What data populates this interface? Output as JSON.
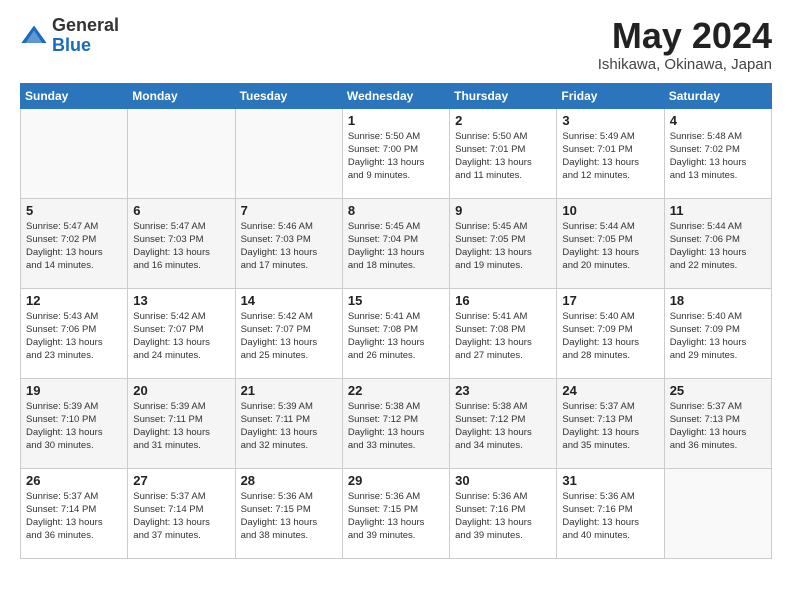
{
  "header": {
    "logo_general": "General",
    "logo_blue": "Blue",
    "title_month": "May 2024",
    "title_location": "Ishikawa, Okinawa, Japan"
  },
  "days_of_week": [
    "Sunday",
    "Monday",
    "Tuesday",
    "Wednesday",
    "Thursday",
    "Friday",
    "Saturday"
  ],
  "weeks": [
    [
      {
        "num": "",
        "info": ""
      },
      {
        "num": "",
        "info": ""
      },
      {
        "num": "",
        "info": ""
      },
      {
        "num": "1",
        "info": "Sunrise: 5:50 AM\nSunset: 7:00 PM\nDaylight: 13 hours\nand 9 minutes."
      },
      {
        "num": "2",
        "info": "Sunrise: 5:50 AM\nSunset: 7:01 PM\nDaylight: 13 hours\nand 11 minutes."
      },
      {
        "num": "3",
        "info": "Sunrise: 5:49 AM\nSunset: 7:01 PM\nDaylight: 13 hours\nand 12 minutes."
      },
      {
        "num": "4",
        "info": "Sunrise: 5:48 AM\nSunset: 7:02 PM\nDaylight: 13 hours\nand 13 minutes."
      }
    ],
    [
      {
        "num": "5",
        "info": "Sunrise: 5:47 AM\nSunset: 7:02 PM\nDaylight: 13 hours\nand 14 minutes."
      },
      {
        "num": "6",
        "info": "Sunrise: 5:47 AM\nSunset: 7:03 PM\nDaylight: 13 hours\nand 16 minutes."
      },
      {
        "num": "7",
        "info": "Sunrise: 5:46 AM\nSunset: 7:03 PM\nDaylight: 13 hours\nand 17 minutes."
      },
      {
        "num": "8",
        "info": "Sunrise: 5:45 AM\nSunset: 7:04 PM\nDaylight: 13 hours\nand 18 minutes."
      },
      {
        "num": "9",
        "info": "Sunrise: 5:45 AM\nSunset: 7:05 PM\nDaylight: 13 hours\nand 19 minutes."
      },
      {
        "num": "10",
        "info": "Sunrise: 5:44 AM\nSunset: 7:05 PM\nDaylight: 13 hours\nand 20 minutes."
      },
      {
        "num": "11",
        "info": "Sunrise: 5:44 AM\nSunset: 7:06 PM\nDaylight: 13 hours\nand 22 minutes."
      }
    ],
    [
      {
        "num": "12",
        "info": "Sunrise: 5:43 AM\nSunset: 7:06 PM\nDaylight: 13 hours\nand 23 minutes."
      },
      {
        "num": "13",
        "info": "Sunrise: 5:42 AM\nSunset: 7:07 PM\nDaylight: 13 hours\nand 24 minutes."
      },
      {
        "num": "14",
        "info": "Sunrise: 5:42 AM\nSunset: 7:07 PM\nDaylight: 13 hours\nand 25 minutes."
      },
      {
        "num": "15",
        "info": "Sunrise: 5:41 AM\nSunset: 7:08 PM\nDaylight: 13 hours\nand 26 minutes."
      },
      {
        "num": "16",
        "info": "Sunrise: 5:41 AM\nSunset: 7:08 PM\nDaylight: 13 hours\nand 27 minutes."
      },
      {
        "num": "17",
        "info": "Sunrise: 5:40 AM\nSunset: 7:09 PM\nDaylight: 13 hours\nand 28 minutes."
      },
      {
        "num": "18",
        "info": "Sunrise: 5:40 AM\nSunset: 7:09 PM\nDaylight: 13 hours\nand 29 minutes."
      }
    ],
    [
      {
        "num": "19",
        "info": "Sunrise: 5:39 AM\nSunset: 7:10 PM\nDaylight: 13 hours\nand 30 minutes."
      },
      {
        "num": "20",
        "info": "Sunrise: 5:39 AM\nSunset: 7:11 PM\nDaylight: 13 hours\nand 31 minutes."
      },
      {
        "num": "21",
        "info": "Sunrise: 5:39 AM\nSunset: 7:11 PM\nDaylight: 13 hours\nand 32 minutes."
      },
      {
        "num": "22",
        "info": "Sunrise: 5:38 AM\nSunset: 7:12 PM\nDaylight: 13 hours\nand 33 minutes."
      },
      {
        "num": "23",
        "info": "Sunrise: 5:38 AM\nSunset: 7:12 PM\nDaylight: 13 hours\nand 34 minutes."
      },
      {
        "num": "24",
        "info": "Sunrise: 5:37 AM\nSunset: 7:13 PM\nDaylight: 13 hours\nand 35 minutes."
      },
      {
        "num": "25",
        "info": "Sunrise: 5:37 AM\nSunset: 7:13 PM\nDaylight: 13 hours\nand 36 minutes."
      }
    ],
    [
      {
        "num": "26",
        "info": "Sunrise: 5:37 AM\nSunset: 7:14 PM\nDaylight: 13 hours\nand 36 minutes."
      },
      {
        "num": "27",
        "info": "Sunrise: 5:37 AM\nSunset: 7:14 PM\nDaylight: 13 hours\nand 37 minutes."
      },
      {
        "num": "28",
        "info": "Sunrise: 5:36 AM\nSunset: 7:15 PM\nDaylight: 13 hours\nand 38 minutes."
      },
      {
        "num": "29",
        "info": "Sunrise: 5:36 AM\nSunset: 7:15 PM\nDaylight: 13 hours\nand 39 minutes."
      },
      {
        "num": "30",
        "info": "Sunrise: 5:36 AM\nSunset: 7:16 PM\nDaylight: 13 hours\nand 39 minutes."
      },
      {
        "num": "31",
        "info": "Sunrise: 5:36 AM\nSunset: 7:16 PM\nDaylight: 13 hours\nand 40 minutes."
      },
      {
        "num": "",
        "info": ""
      }
    ]
  ]
}
